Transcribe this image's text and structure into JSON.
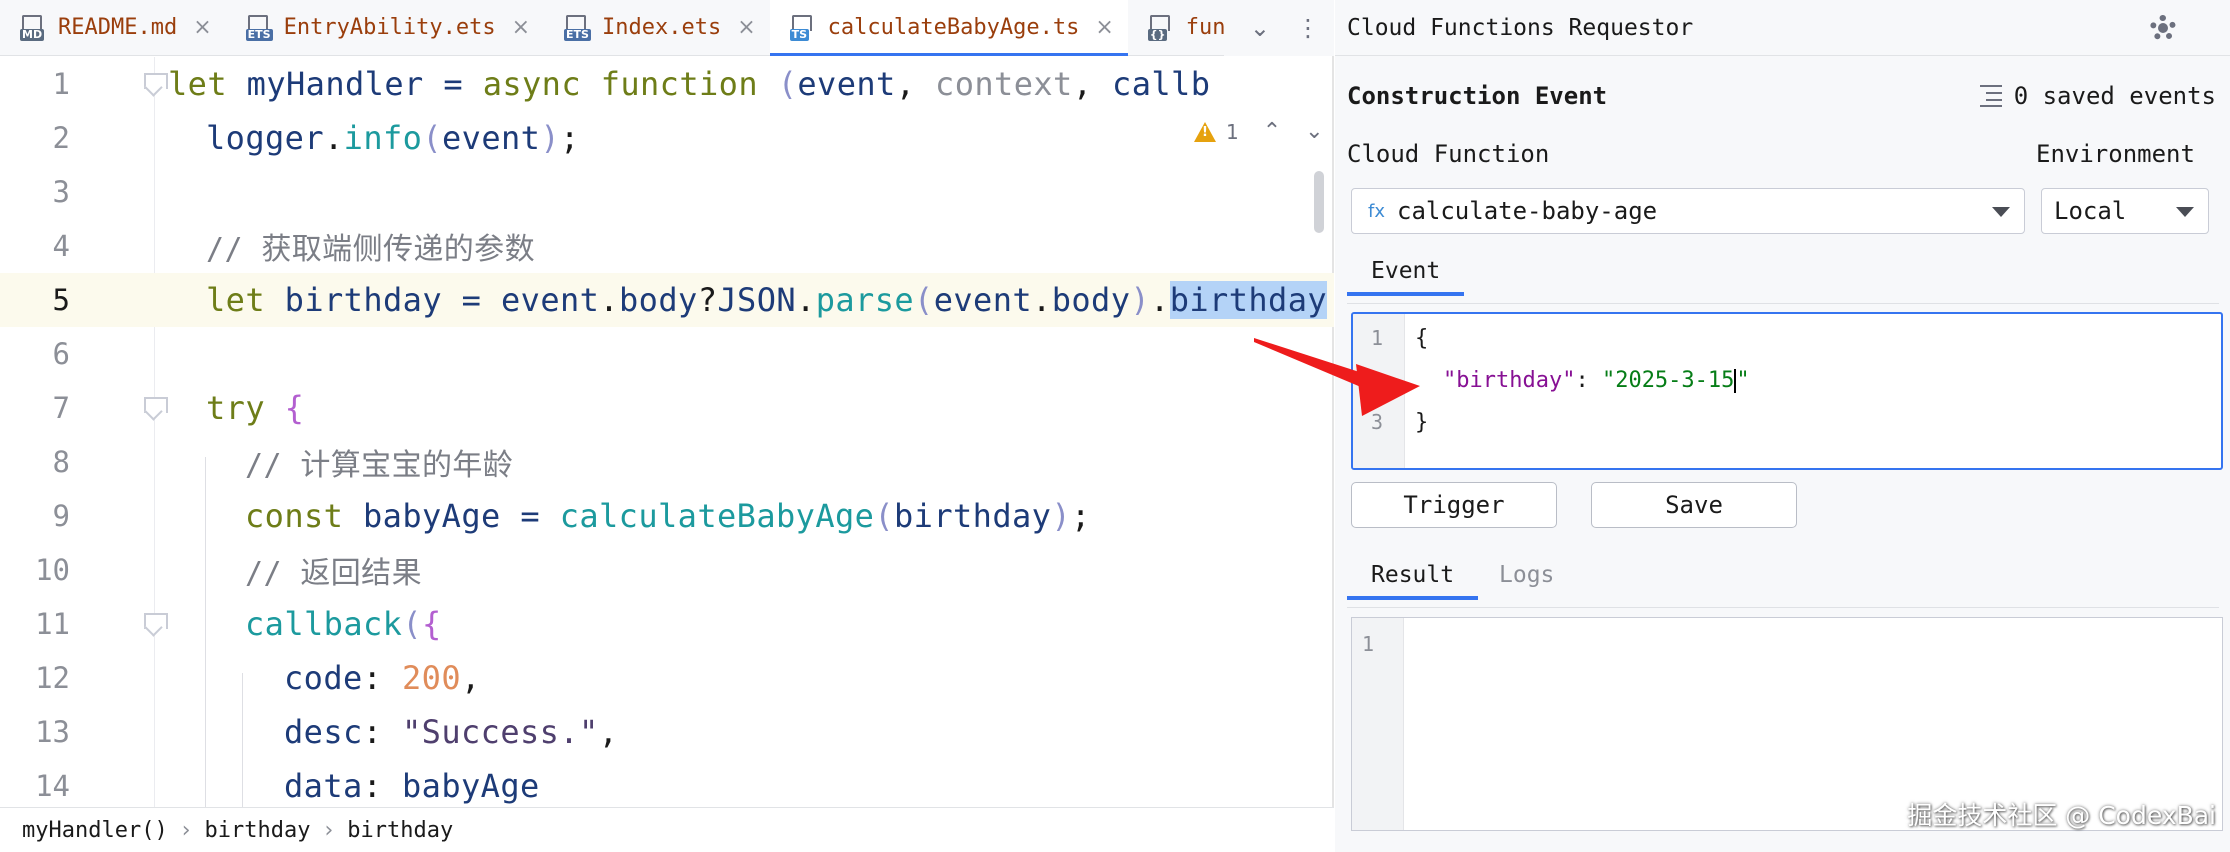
{
  "editor": {
    "tabs": [
      {
        "label": "README.md",
        "badge": "MD",
        "active": false
      },
      {
        "label": "EntryAbility.ets",
        "badge": "ETS",
        "active": false
      },
      {
        "label": "Index.ets",
        "badge": "ETS",
        "active": false
      },
      {
        "label": "calculateBabyAge.ts",
        "badge": "TS",
        "active": true
      },
      {
        "label": "func",
        "badge": "{}",
        "active": false
      }
    ],
    "tab_close_glyph": "×",
    "inspection": {
      "warnings": "1"
    },
    "line_numbers": [
      "1",
      "2",
      "3",
      "4",
      "5",
      "6",
      "7",
      "8",
      "9",
      "10",
      "11",
      "12",
      "13",
      "14"
    ],
    "comment_line4": "// 获取端侧传递的参数",
    "comment_line8": "// 计算宝宝的年龄",
    "comment_line10": "// 返回结果",
    "desc_value": "\"Success.\"",
    "code_value": "200",
    "current_line": 5
  },
  "breadcrumb": [
    "myHandler()",
    "birthday",
    "birthday"
  ],
  "panel": {
    "title": "Cloud Functions Requestor",
    "section_title": "Construction Event",
    "saved_events": "0 saved events",
    "cloud_function_label": "Cloud Function",
    "environment_label": "Environment",
    "cloud_function_value": "calculate-baby-age",
    "cloud_function_prefix": "fx",
    "environment_value": "Local",
    "event_tab": "Event",
    "event_json": {
      "line_numbers": [
        "1",
        "2",
        "3"
      ],
      "open": "{",
      "key": "\"birthday\"",
      "colon": ": ",
      "value": "\"2025-3-15",
      "value_end": "\"",
      "close": "}"
    },
    "trigger_label": "Trigger",
    "save_label": "Save",
    "result_tabs": [
      "Result",
      "Logs"
    ],
    "result_line_numbers": [
      "1"
    ]
  },
  "watermark": "掘金技术社区 @ CodexBai",
  "colors": {
    "accent": "#3574f0",
    "annotation_arrow": "#ee1c1c",
    "warning": "#e6a20e"
  }
}
